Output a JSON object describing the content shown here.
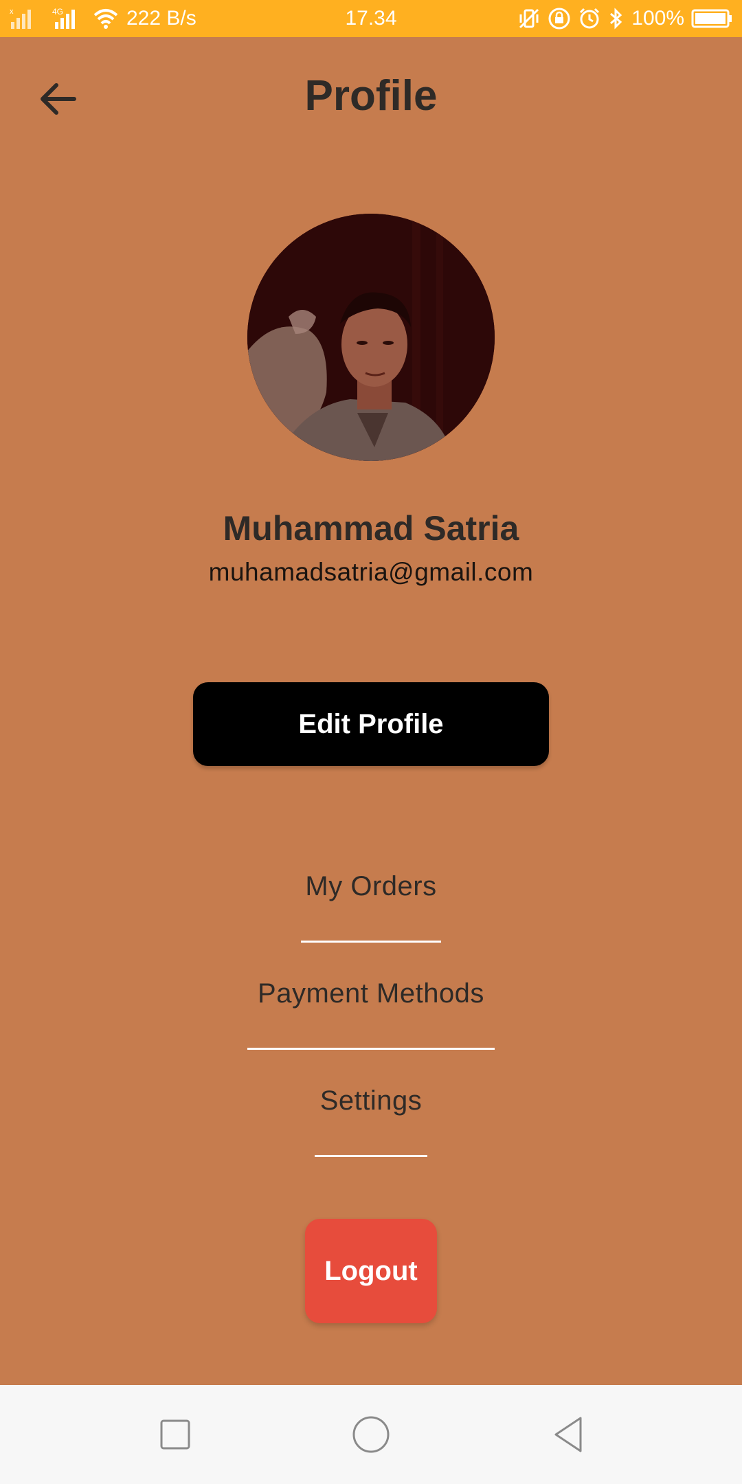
{
  "status_bar": {
    "network_speed": "222 B/s",
    "time": "17.34",
    "battery": "100%",
    "signal_label": "4G"
  },
  "header": {
    "title": "Profile"
  },
  "profile": {
    "name": "Muhammad Satria",
    "email": "muhamadsatria@gmail.com"
  },
  "actions": {
    "edit_profile_label": "Edit Profile",
    "logout_label": "Logout"
  },
  "menu": {
    "items": [
      {
        "label": "My Orders"
      },
      {
        "label": "Payment Methods"
      },
      {
        "label": "Settings"
      }
    ]
  },
  "colors": {
    "background": "#C67C4E",
    "status_bar": "#FFB020",
    "text_dark": "#2E2A27",
    "edit_button": "#000000",
    "logout_button": "#E74C3C",
    "divider": "#FFFFFF",
    "nav_bar": "#F7F7F7"
  },
  "icons": {
    "back": "arrow-left-icon",
    "nav_recent": "square-icon",
    "nav_home": "circle-icon",
    "nav_back": "triangle-back-icon"
  }
}
